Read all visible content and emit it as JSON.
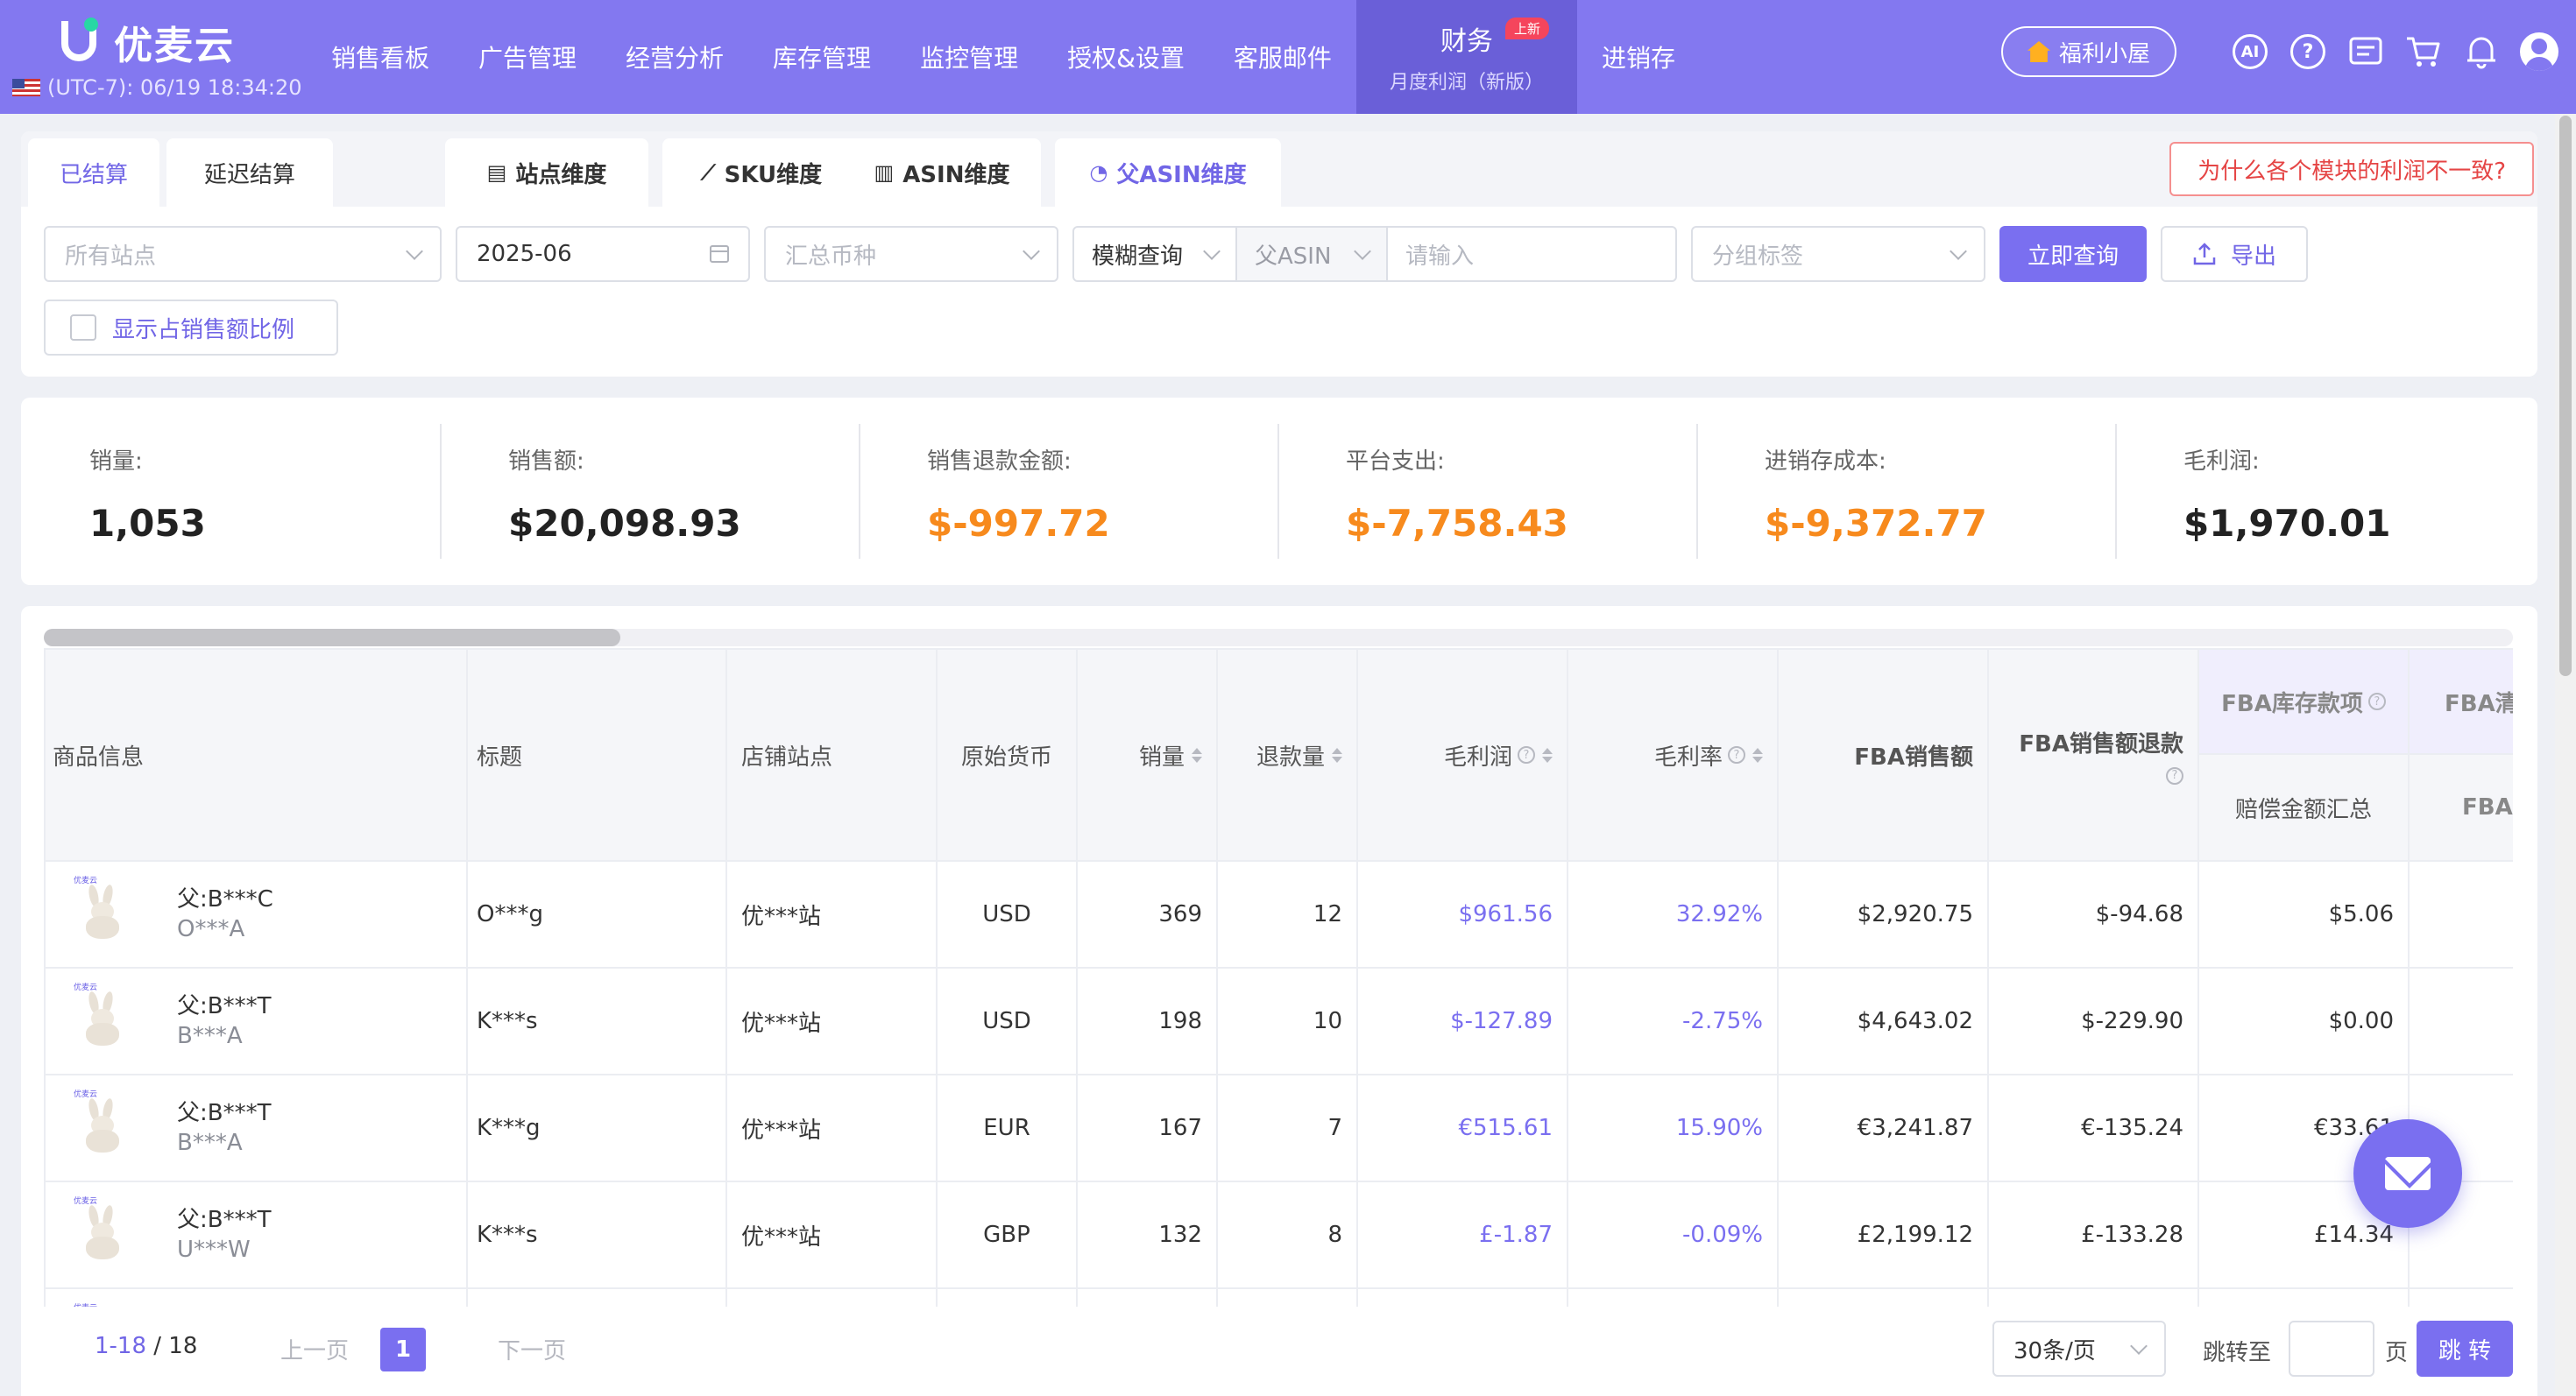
{
  "app": {
    "logo_text": "优麦云",
    "timezone": "(UTC-7): 06/19 18:34:20"
  },
  "nav": {
    "items": [
      "销售看板",
      "广告管理",
      "经营分析",
      "库存管理",
      "监控管理",
      "授权&设置",
      "客服邮件"
    ],
    "active_title": "财务",
    "active_sub": "月度利润（新版）",
    "active_badge": "上新",
    "after": "进销存"
  },
  "topright": {
    "perk_label": "福利小屋",
    "icons": [
      "ai-icon",
      "help-icon",
      "message-icon",
      "cart-icon",
      "bell-icon",
      "avatar-icon"
    ]
  },
  "tabs": {
    "settled": "已结算",
    "deferred": "延迟结算",
    "site_dim": "站点维度",
    "sku_dim": "SKU维度",
    "asin_dim": "ASIN维度",
    "parent_asin_dim": "父ASIN维度",
    "why_btn": "为什么各个模块的利润不一致?"
  },
  "filters": {
    "site_placeholder": "所有站点",
    "month_value": "2025-06",
    "currency_placeholder": "汇总币种",
    "search_mode": "模糊查询",
    "search_type": "父ASIN",
    "search_placeholder": "请输入",
    "group_placeholder": "分组标签",
    "query_btn": "立即查询",
    "export_btn": "导出",
    "show_ratio_label": "显示占销售额比例"
  },
  "summary": [
    {
      "label": "销量:",
      "value": "1,053",
      "color": "#222222"
    },
    {
      "label": "销售额:",
      "value": "$20,098.93",
      "color": "#222222"
    },
    {
      "label": "销售退款金额:",
      "value": "$-997.72",
      "color": "#f78a1d"
    },
    {
      "label": "平台支出:",
      "value": "$-7,758.43",
      "color": "#f78a1d"
    },
    {
      "label": "进销存成本:",
      "value": "$-9,372.77",
      "color": "#f78a1d"
    },
    {
      "label": "毛利润:",
      "value": "$1,970.01",
      "color": "#222222"
    }
  ],
  "table": {
    "headers": {
      "product": "商品信息",
      "title": "标题",
      "store": "店铺站点",
      "currency": "原始货币",
      "qty": "销量",
      "refund_qty": "退款量",
      "profit": "毛利润",
      "margin": "毛利率",
      "fba_sales": "FBA销售额",
      "fba_refund": "FBA销售额退款",
      "fba_inventory": "FBA库存款项",
      "fba_inventory_sub": "赔偿金额汇总",
      "fba_clear": "FBA清",
      "fba_clear_sub": "FBA"
    },
    "rows": [
      {
        "parent": "父:B***C",
        "child": "O***A",
        "title": "O***g",
        "store": "优***站",
        "currency": "USD",
        "qty": "369",
        "refund": "12",
        "profit": "$961.56",
        "margin": "32.92%",
        "fba_sales": "$2,920.75",
        "fba_refund": "$-94.68",
        "fba_inv": "$5.06"
      },
      {
        "parent": "父:B***T",
        "child": "B***A",
        "title": "K***s",
        "store": "优***站",
        "currency": "USD",
        "qty": "198",
        "refund": "10",
        "profit": "$-127.89",
        "margin": "-2.75%",
        "fba_sales": "$4,643.02",
        "fba_refund": "$-229.90",
        "fba_inv": "$0.00"
      },
      {
        "parent": "父:B***T",
        "child": "B***A",
        "title": "K***g",
        "store": "优***站",
        "currency": "EUR",
        "qty": "167",
        "refund": "7",
        "profit": "€515.61",
        "margin": "15.90%",
        "fba_sales": "€3,241.87",
        "fba_refund": "€-135.24",
        "fba_inv": "€33.61"
      },
      {
        "parent": "父:B***T",
        "child": "U***W",
        "title": "K***s",
        "store": "优***站",
        "currency": "GBP",
        "qty": "132",
        "refund": "8",
        "profit": "£-1.87",
        "margin": "-0.09%",
        "fba_sales": "£2,199.12",
        "fba_refund": "£-133.28",
        "fba_inv": "£14.34"
      }
    ]
  },
  "pager": {
    "range": "1-18",
    "total": "/ 18",
    "prev": "上一页",
    "current": "1",
    "next": "下一页",
    "page_size": "30条/页",
    "jump_label": "跳转至",
    "page_label": "页",
    "jump_btn": "跳 转"
  },
  "brand_thumb_text": "优麦云"
}
